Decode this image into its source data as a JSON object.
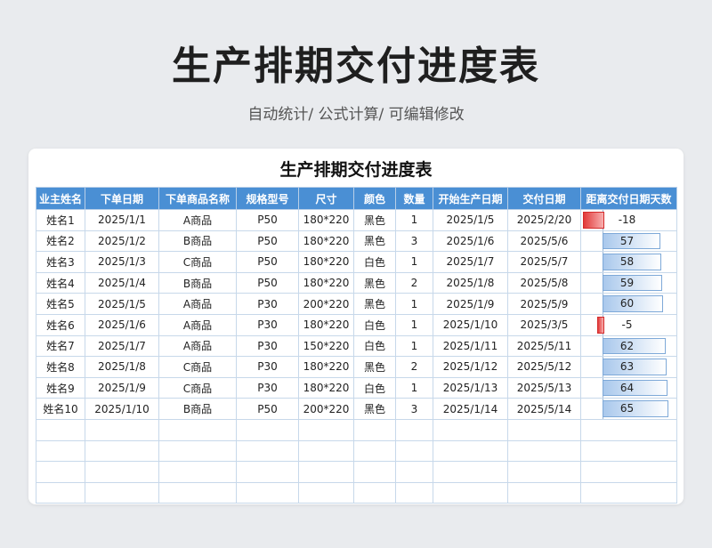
{
  "page": {
    "title": "生产排期交付进度表",
    "subtitle": "自动统计/ 公式计算/ 可编辑修改"
  },
  "sheet": {
    "title": "生产排期交付进度表",
    "headers": [
      "业主姓名",
      "下单日期",
      "下单商品名称",
      "规格型号",
      "尺寸",
      "颜色",
      "数量",
      "开始生产日期",
      "交付日期",
      "距离交付日期天数"
    ],
    "rows": [
      [
        "姓名1",
        "2025/1/1",
        "A商品",
        "P50",
        "180*220",
        "黑色",
        "1",
        "2025/1/5",
        "2025/2/20",
        -18
      ],
      [
        "姓名2",
        "2025/1/2",
        "B商品",
        "P50",
        "180*220",
        "黑色",
        "3",
        "2025/1/6",
        "2025/5/6",
        57
      ],
      [
        "姓名3",
        "2025/1/3",
        "C商品",
        "P50",
        "180*220",
        "白色",
        "1",
        "2025/1/7",
        "2025/5/7",
        58
      ],
      [
        "姓名4",
        "2025/1/4",
        "B商品",
        "P50",
        "180*220",
        "黑色",
        "2",
        "2025/1/8",
        "2025/5/8",
        59
      ],
      [
        "姓名5",
        "2025/1/5",
        "A商品",
        "P30",
        "200*220",
        "黑色",
        "1",
        "2025/1/9",
        "2025/5/9",
        60
      ],
      [
        "姓名6",
        "2025/1/6",
        "A商品",
        "P30",
        "180*220",
        "白色",
        "1",
        "2025/1/10",
        "2025/3/5",
        -5
      ],
      [
        "姓名7",
        "2025/1/7",
        "A商品",
        "P30",
        "150*220",
        "白色",
        "1",
        "2025/1/11",
        "2025/5/11",
        62
      ],
      [
        "姓名8",
        "2025/1/8",
        "C商品",
        "P30",
        "180*220",
        "黑色",
        "2",
        "2025/1/12",
        "2025/5/12",
        63
      ],
      [
        "姓名9",
        "2025/1/9",
        "C商品",
        "P30",
        "180*220",
        "白色",
        "1",
        "2025/1/13",
        "2025/5/13",
        64
      ],
      [
        "姓名10",
        "2025/1/10",
        "B商品",
        "P50",
        "200*220",
        "黑色",
        "3",
        "2025/1/14",
        "2025/5/14",
        65
      ]
    ],
    "empty_rows": 4,
    "colors": {
      "header_bg": "#4a8fd4",
      "positive_bar": "#a9c8ec",
      "negative_bar": "#e23a3a"
    }
  }
}
